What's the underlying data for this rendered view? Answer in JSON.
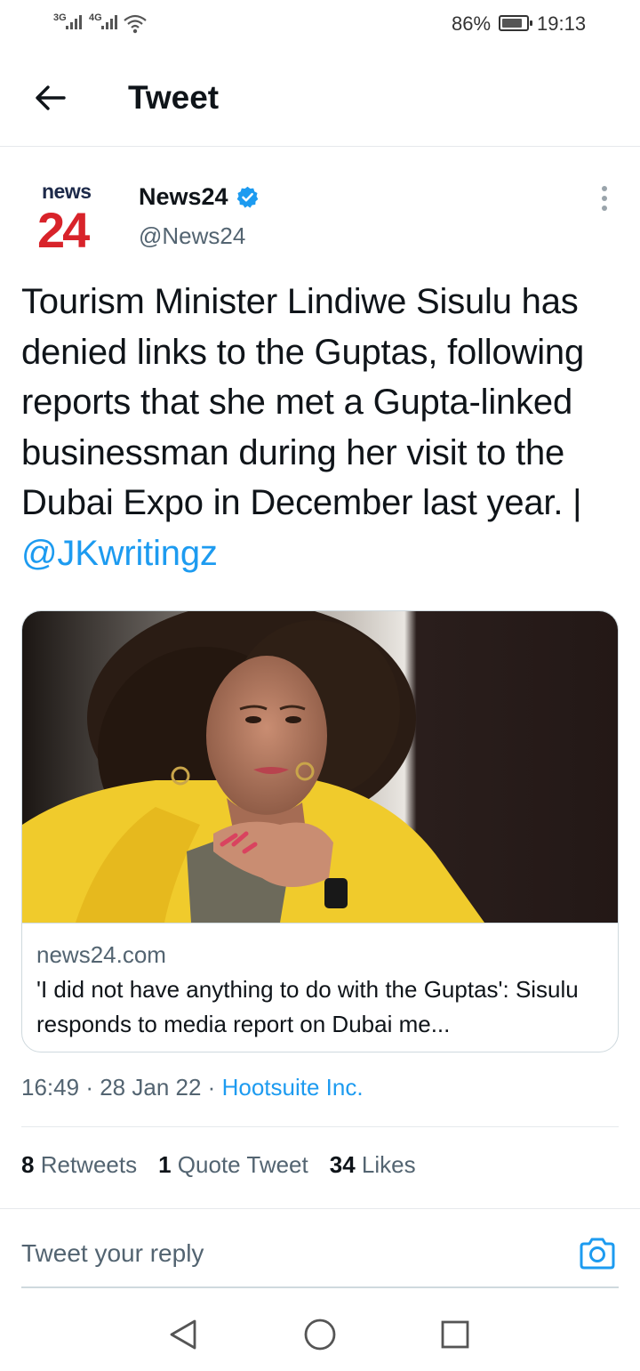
{
  "status_bar": {
    "signal_1": "3G",
    "signal_2": "4G",
    "battery_percent": "86%",
    "battery_level": 0.86,
    "time": "19:13"
  },
  "header": {
    "title": "Tweet",
    "back_icon": "arrow-left-icon"
  },
  "tweet": {
    "author": {
      "logo_word": "news",
      "logo_number": "24",
      "name": "News24",
      "verified_icon": "verified-badge-icon",
      "handle": "@News24"
    },
    "more_icon": "more-vertical-icon",
    "text": "Tourism Minister Lindiwe Sisulu has denied links to the Guptas, following reports that she met a Gupta-linked businessman during her visit to the Dubai Expo in December last year. | ",
    "mention": "@JKwritingz",
    "card": {
      "domain": "news24.com",
      "title": "'I did not have anything to do with the Guptas': Sisulu responds to media report on Dubai me..."
    },
    "time": "16:49",
    "date": "28 Jan 22",
    "source": "Hootsuite Inc.",
    "separator": "·",
    "stats": {
      "retweets_count": "8",
      "retweets_label": "Retweets",
      "quotes_count": "1",
      "quotes_label": "Quote Tweet",
      "likes_count": "34",
      "likes_label": "Likes"
    }
  },
  "reply": {
    "placeholder": "Tweet your reply",
    "camera_icon": "camera-icon"
  },
  "nav": {
    "back_icon": "nav-back-triangle-icon",
    "home_icon": "nav-home-circle-icon",
    "recents_icon": "nav-recents-square-icon"
  },
  "colors": {
    "link_blue": "#1d9bf0",
    "text_primary": "#0f1419",
    "text_secondary": "#536471",
    "news24_red": "#d8232a"
  }
}
